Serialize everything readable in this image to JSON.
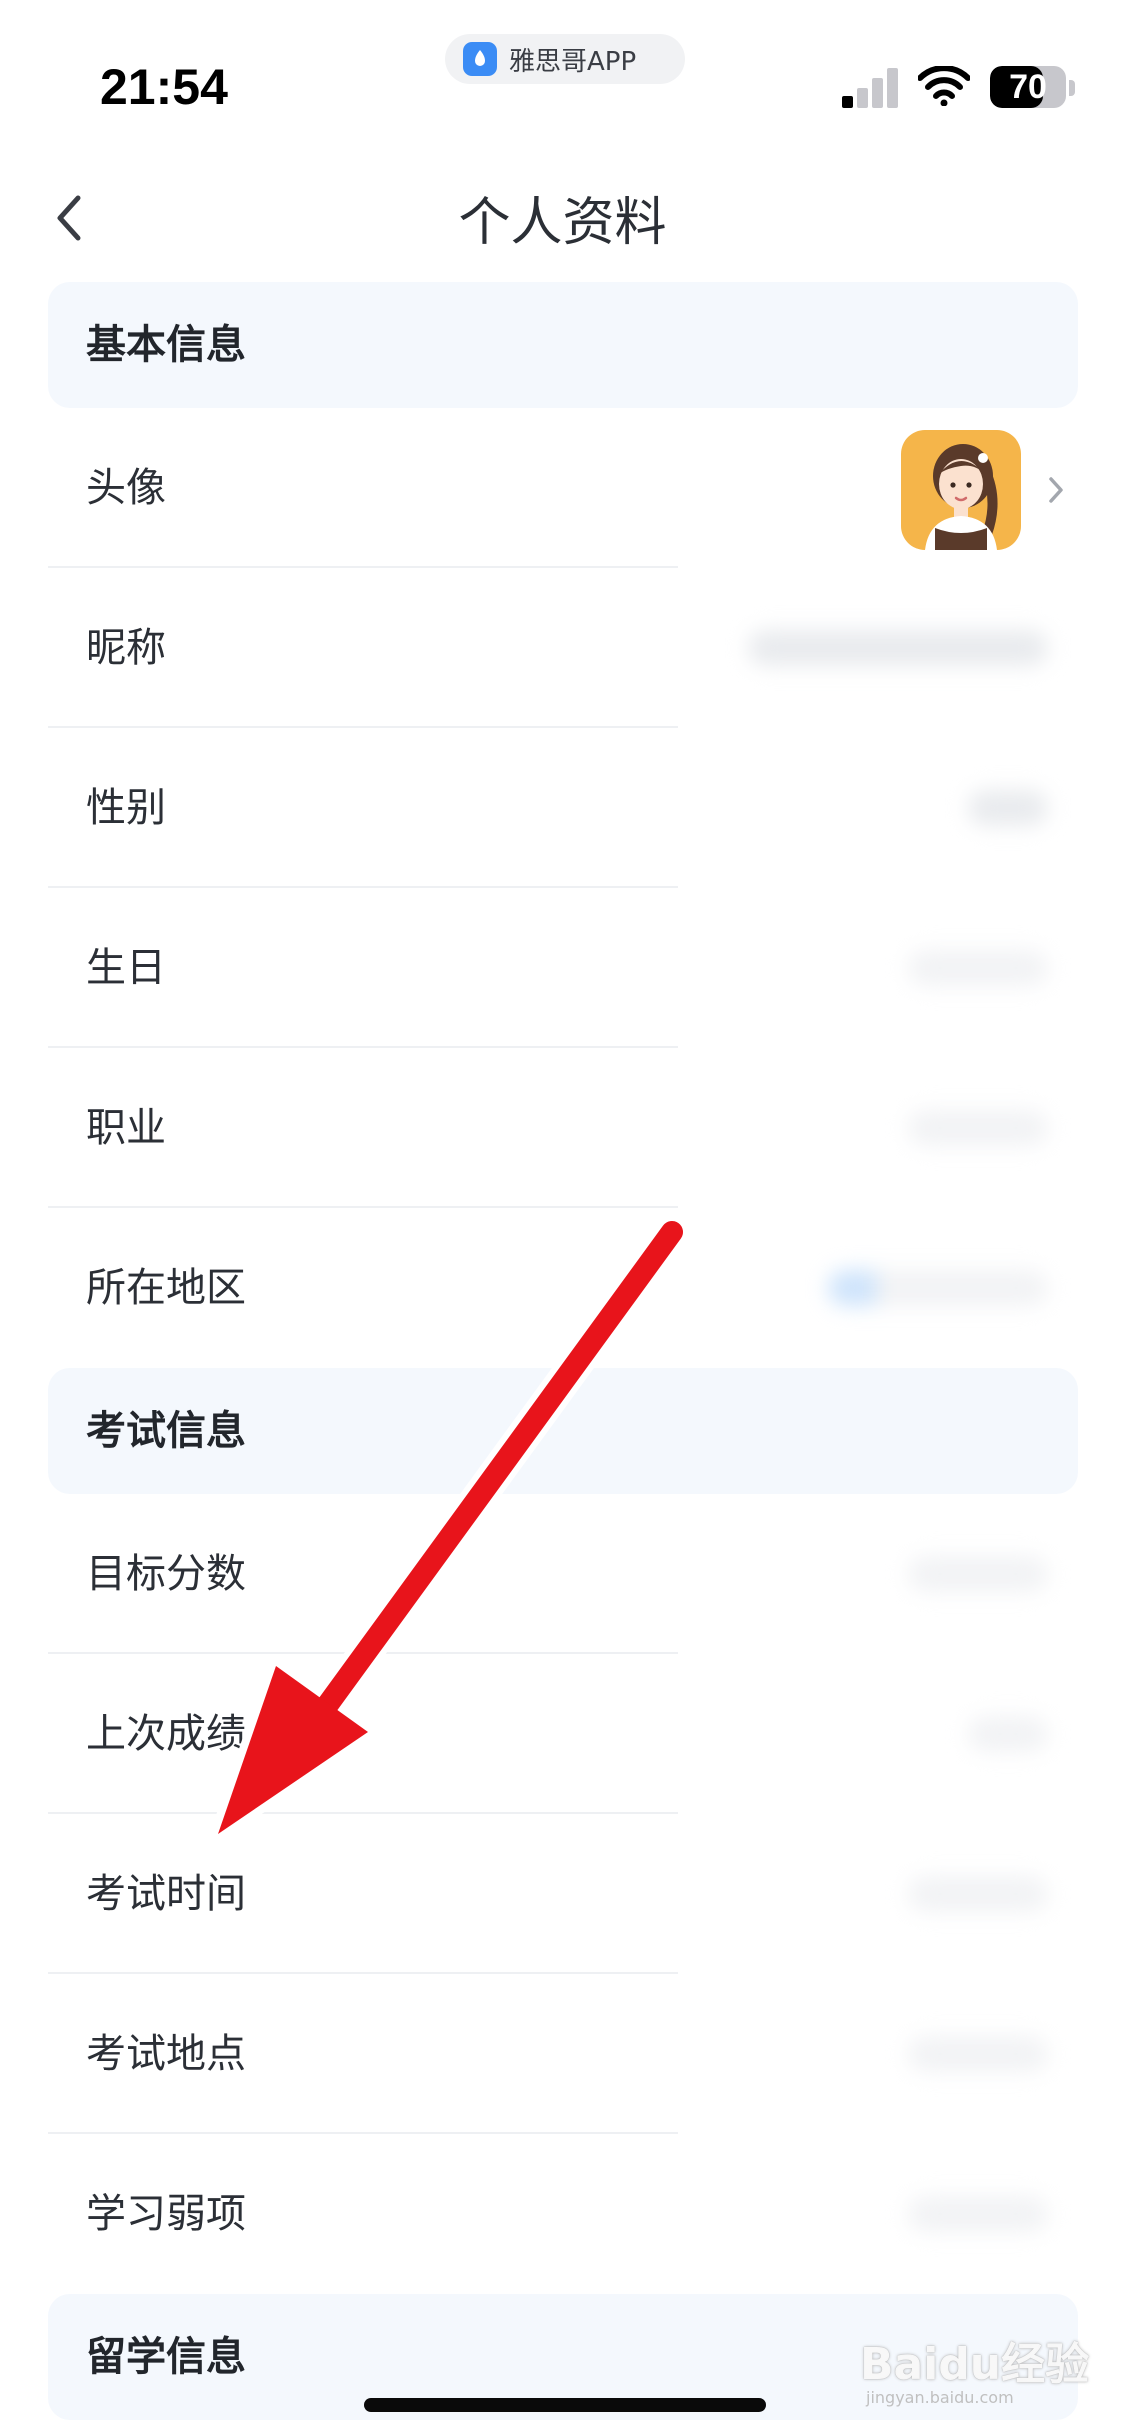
{
  "status_bar": {
    "time": "21:54",
    "app_name": "雅思哥APP",
    "battery": "70",
    "battery_level": 0.7
  },
  "nav": {
    "title": "个人资料"
  },
  "sections": {
    "basic": "基本信息",
    "exam": "考试信息",
    "study_abroad": "留学信息"
  },
  "rows": {
    "avatar": "头像",
    "nickname": "昵称",
    "gender": "性别",
    "birthday": "生日",
    "occupation": "职业",
    "region": "所在地区",
    "target_score": "目标分数",
    "last_score": "上次成绩",
    "exam_time": "考试时间",
    "exam_location": "考试地点",
    "weak_item": "学习弱项"
  },
  "watermark": {
    "brand": "Baidu经验",
    "url": "jingyan.baidu.com"
  },
  "colors": {
    "annotation_arrow": "#e8141b",
    "section_bg": "#f4f8fd",
    "avatar_bg": "#f5b54a"
  }
}
